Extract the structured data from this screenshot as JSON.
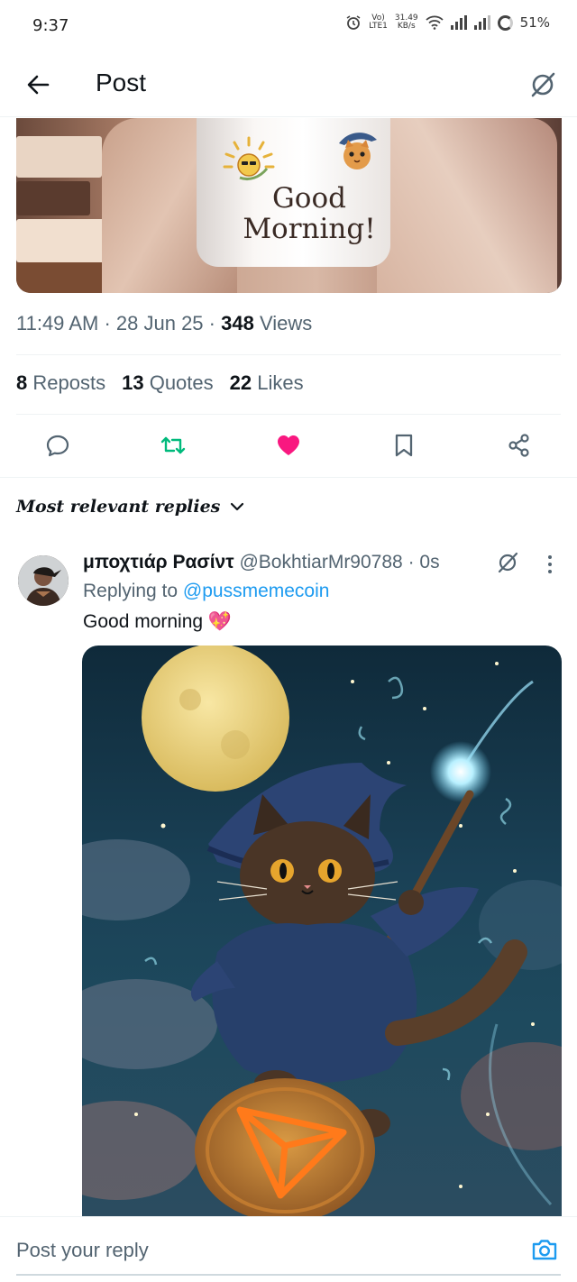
{
  "status_bar": {
    "time": "9:37",
    "network_top": "Vo)",
    "network_bottom": "LTE1",
    "speed_top": "31.49",
    "speed_bottom": "KB/s",
    "battery": "51%"
  },
  "header": {
    "title": "Post"
  },
  "post": {
    "media_text_line1": "Good",
    "media_text_line2": "Morning!",
    "time": "11:49 AM",
    "date": "28 Jun 25",
    "views_count": "348",
    "views_label": "Views",
    "reposts_count": "8",
    "reposts_label": "Reposts",
    "quotes_count": "13",
    "quotes_label": "Quotes",
    "likes_count": "22",
    "likes_label": "Likes"
  },
  "colors": {
    "repost_green": "#00ba7c",
    "like_pink": "#f91880",
    "link_blue": "#1d9bf0",
    "muted": "#536471"
  },
  "actions": [
    "reply-icon",
    "repost-icon",
    "like-icon",
    "bookmark-icon",
    "share-icon"
  ],
  "replies_sort": {
    "label": "Most relevant replies"
  },
  "reply": {
    "display_name": "μποχτιάρ Ρασίντ",
    "handle": "@BokhtiarMr90788",
    "time": "0s",
    "replying_prefix": "Replying to",
    "replying_to": "@pussmemecoin",
    "text": "Good morning 💖"
  },
  "compose": {
    "placeholder": "Post your reply"
  }
}
